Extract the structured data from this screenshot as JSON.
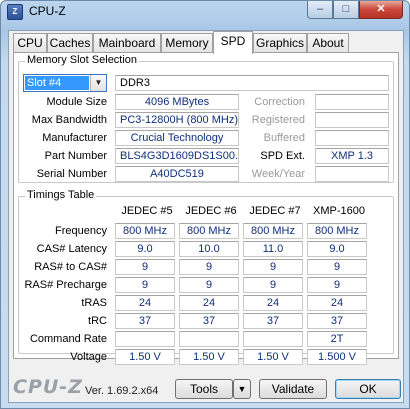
{
  "window": {
    "title": "CPU-Z",
    "icon": "cpu-z-app-icon",
    "buttons": {
      "minimize": "–",
      "maximize": "□",
      "close": "✕"
    }
  },
  "tabs": [
    {
      "label": "CPU",
      "active": false
    },
    {
      "label": "Caches",
      "active": false
    },
    {
      "label": "Mainboard",
      "active": false
    },
    {
      "label": "Memory",
      "active": false
    },
    {
      "label": "SPD",
      "active": true
    },
    {
      "label": "Graphics",
      "active": false
    },
    {
      "label": "About",
      "active": false
    }
  ],
  "slot": {
    "group_title": "Memory Slot Selection",
    "selected_slot": "Slot #4",
    "memory_type": "DDR3",
    "labels": {
      "module_size": "Module Size",
      "max_bandwidth": "Max Bandwidth",
      "manufacturer": "Manufacturer",
      "part_number": "Part Number",
      "serial_number": "Serial Number",
      "correction": "Correction",
      "registered": "Registered",
      "buffered": "Buffered",
      "spd_ext": "SPD Ext.",
      "week_year": "Week/Year"
    },
    "values": {
      "module_size": "4096 MBytes",
      "max_bandwidth": "PC3-12800H (800 MHz)",
      "manufacturer": "Crucial Technology",
      "part_number": "BLS4G3D1609DS1S00.",
      "serial_number": "A40DC519",
      "correction": "",
      "registered": "",
      "buffered": "",
      "spd_ext": "XMP 1.3",
      "week_year": ""
    }
  },
  "timings": {
    "group_title": "Timings Table",
    "columns": [
      "JEDEC #5",
      "JEDEC #6",
      "JEDEC #7",
      "XMP-1600"
    ],
    "rows": [
      {
        "label": "Frequency",
        "values": [
          "800 MHz",
          "800 MHz",
          "800 MHz",
          "800 MHz"
        ]
      },
      {
        "label": "CAS# Latency",
        "values": [
          "9.0",
          "10.0",
          "11.0",
          "9.0"
        ]
      },
      {
        "label": "RAS# to CAS#",
        "values": [
          "9",
          "9",
          "9",
          "9"
        ]
      },
      {
        "label": "RAS# Precharge",
        "values": [
          "9",
          "9",
          "9",
          "9"
        ]
      },
      {
        "label": "tRAS",
        "values": [
          "24",
          "24",
          "24",
          "24"
        ]
      },
      {
        "label": "tRC",
        "values": [
          "37",
          "37",
          "37",
          "37"
        ]
      },
      {
        "label": "Command Rate",
        "values": [
          "",
          "",
          "",
          "2T"
        ]
      },
      {
        "label": "Voltage",
        "values": [
          "1.50 V",
          "1.50 V",
          "1.50 V",
          "1.500 V"
        ]
      }
    ]
  },
  "footer": {
    "brand": "CPU-Z",
    "version": "Ver. 1.69.2.x64",
    "tools_label": "Tools",
    "tools_arrow": "▼",
    "validate_label": "Validate",
    "ok_label": "OK"
  }
}
